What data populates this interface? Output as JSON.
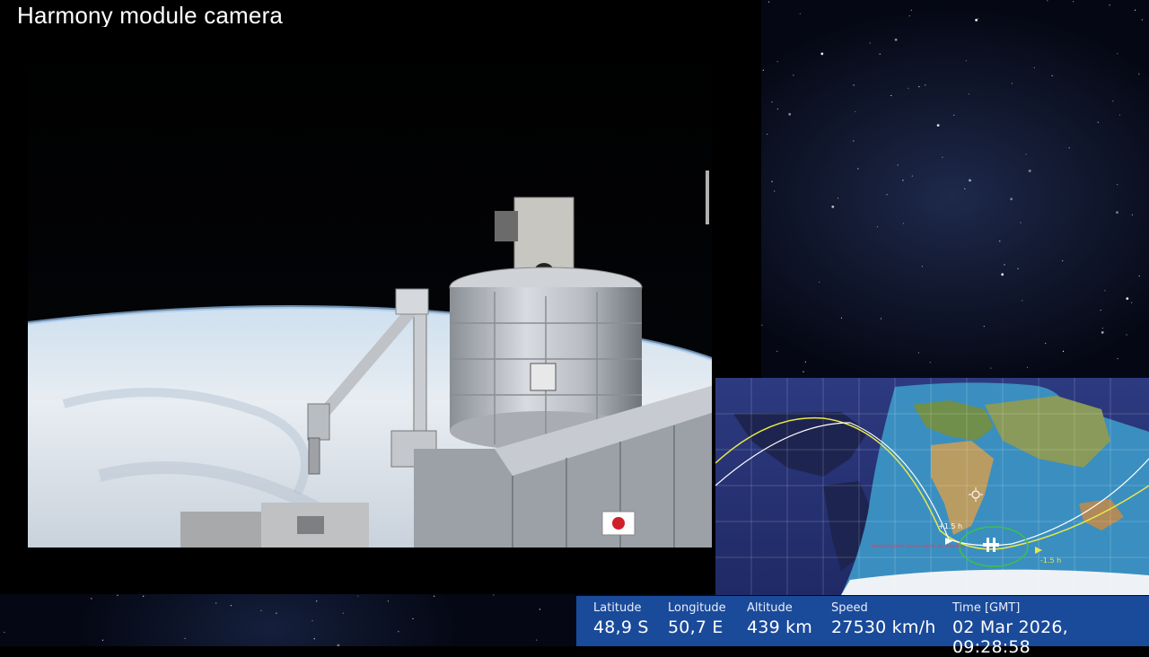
{
  "title": "Harmony module camera",
  "map": {
    "label_plus": "+1.5 h",
    "label_minus": "-1.5 h",
    "caption": "Predicted path shows speed, alt, heading"
  },
  "telemetry": {
    "latitude_label": "Latitude",
    "latitude_value": "48,9 S",
    "longitude_label": "Longitude",
    "longitude_value": "50,7 E",
    "altitude_label": "Altitude",
    "altitude_value": "439 km",
    "speed_label": "Speed",
    "speed_value": "27530 km/h",
    "time_label": "Time [GMT]",
    "time_value": "02 Mar 2026, 09:28:58"
  },
  "colors": {
    "infobar": "#1a4a9a",
    "ground_track_future": "#e8e84a",
    "ground_track_past": "#ffffff",
    "daylight_ocean": "#3a8fc0",
    "night_ocean": "#24306a"
  }
}
